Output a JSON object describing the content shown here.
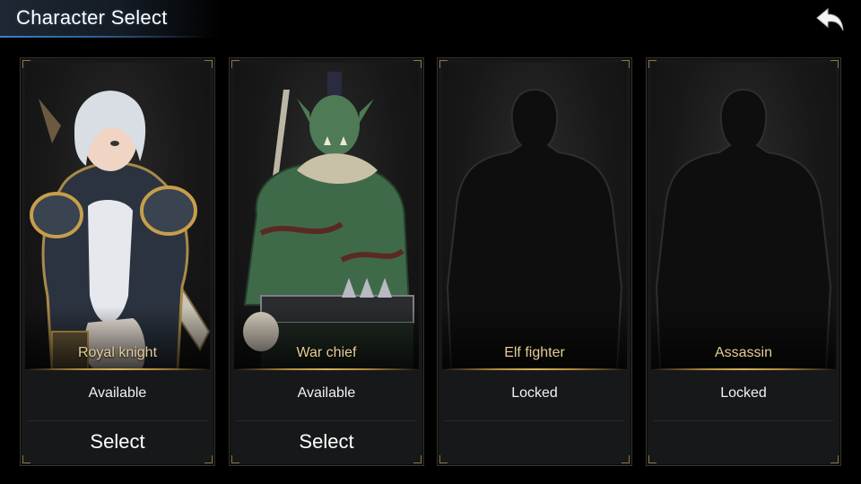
{
  "header": {
    "title": "Character Select",
    "back_icon": "back-arrow-icon"
  },
  "colors": {
    "accent_blue": "#3b82c4",
    "gold": "#d9b060",
    "name_gold": "#e6cf96",
    "card_bg": "#17181a"
  },
  "characters": [
    {
      "name": "Royal knight",
      "status": "Available",
      "button": "Select",
      "locked": false,
      "art": "royal-knight"
    },
    {
      "name": "War chief",
      "status": "Available",
      "button": "Select",
      "locked": false,
      "art": "war-chief"
    },
    {
      "name": "Elf fighter",
      "status": "Locked",
      "button": "",
      "locked": true,
      "art": "silhouette"
    },
    {
      "name": "Assassin",
      "status": "Locked",
      "button": "",
      "locked": true,
      "art": "silhouette"
    }
  ]
}
